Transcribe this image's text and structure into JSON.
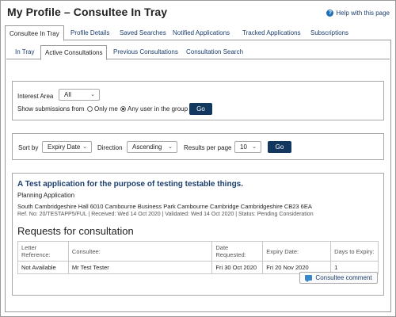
{
  "page": {
    "title": "My Profile – Consultee In Tray",
    "help_label": "Help with this page",
    "help_icon": "question-icon"
  },
  "tabs": [
    {
      "label": "Consultee In Tray",
      "active": true
    },
    {
      "label": "Profile Details",
      "active": false
    },
    {
      "label": "Saved Searches",
      "active": false
    },
    {
      "label": "Notified Applications",
      "active": false
    },
    {
      "label": "Tracked Applications",
      "active": false
    },
    {
      "label": "Subscriptions",
      "active": false
    }
  ],
  "subtabs": [
    {
      "label": "In Tray",
      "active": false
    },
    {
      "label": "Active Consultations",
      "active": true
    },
    {
      "label": "Previous Consultations",
      "active": false
    },
    {
      "label": "Consultation Search",
      "active": false
    }
  ],
  "filter": {
    "interest_label": "Interest Area",
    "interest_value": "All",
    "show_label": "Show submissions from",
    "option_only_me": "Only me",
    "option_any_user": "Any user in the group",
    "selected_option": "any_user",
    "go_label": "Go"
  },
  "sort": {
    "sort_by_label": "Sort by",
    "sort_by_value": "Expiry Date",
    "direction_label": "Direction",
    "direction_value": "Ascending",
    "results_label": "Results per page",
    "results_value": "10",
    "go_label": "Go"
  },
  "application": {
    "title": "A Test application for the purpose of testing testable things.",
    "type": "Planning Application",
    "address": "South Cambridgeshire Hall 6010 Cambourne Business Park Cambourne Cambridge Cambridgeshire CB23 6EA",
    "meta": {
      "ref": "Ref. No: 20/TESTAPP5/FUL",
      "received": "Received: Wed 14 Oct 2020",
      "validated": "Validated: Wed 14 Oct 2020",
      "status": "Status: Pending Consideration"
    }
  },
  "requests": {
    "title": "Requests for consultation",
    "columns": [
      "Letter Reference:",
      "Consultee:",
      "Date Requested:",
      "Expiry Date:",
      "Days to Expiry:"
    ],
    "rows": [
      [
        "Not Available",
        "Mr Test Tester",
        "Fri 30 Oct 2020",
        "Fri 20 Nov 2020",
        "1"
      ]
    ],
    "comment_button": "Consultee comment",
    "comment_icon": "comment-icon"
  },
  "colors": {
    "link": "#1c3f6e",
    "button": "#12385f",
    "border": "#9a9a9a"
  }
}
